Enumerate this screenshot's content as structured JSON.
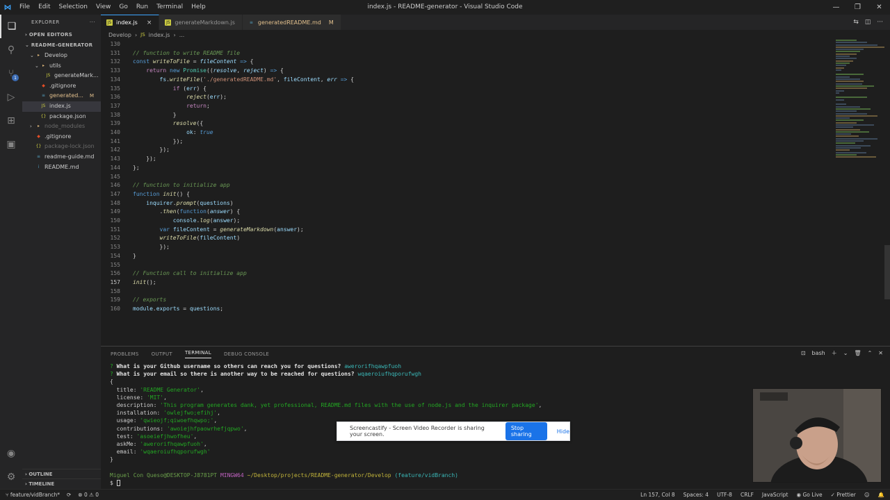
{
  "window": {
    "title": "index.js - README-generator - Visual Studio Code",
    "menu": [
      "File",
      "Edit",
      "Selection",
      "View",
      "Go",
      "Run",
      "Terminal",
      "Help"
    ]
  },
  "sidebar": {
    "header": "EXPLORER",
    "open_editors": "OPEN EDITORS",
    "project": "README-GENERATOR",
    "tree": [
      {
        "label": "Develop",
        "kind": "folder",
        "depth": 1,
        "open": true
      },
      {
        "label": "utils",
        "kind": "folder",
        "depth": 2,
        "open": true
      },
      {
        "label": "generateMark...",
        "kind": "js",
        "depth": 3
      },
      {
        "label": ".gitignore",
        "kind": "git",
        "depth": 2
      },
      {
        "label": "generated...",
        "kind": "md",
        "depth": 2,
        "mark": "M"
      },
      {
        "label": "index.js",
        "kind": "js",
        "depth": 2,
        "selected": true
      },
      {
        "label": "package.json",
        "kind": "json",
        "depth": 2
      },
      {
        "label": "node_modules",
        "kind": "folder",
        "depth": 1,
        "dim": true
      },
      {
        "label": ".gitignore",
        "kind": "git",
        "depth": 1
      },
      {
        "label": "package-lock.json",
        "kind": "json",
        "depth": 1,
        "dim": true
      },
      {
        "label": "readme-guide.md",
        "kind": "md",
        "depth": 1
      },
      {
        "label": "README.md",
        "kind": "info",
        "depth": 1
      }
    ],
    "outline": "OUTLINE",
    "timeline": "TIMELINE"
  },
  "tabs": [
    {
      "label": "index.js",
      "icon": "js-icon",
      "active": true,
      "close": "×"
    },
    {
      "label": "generateMarkdown.js",
      "icon": "js-icon"
    },
    {
      "label": "generatedREADME.md",
      "icon": "markdown-icon",
      "mark": "M"
    }
  ],
  "breadcrumb": [
    "Develop",
    "index.js",
    "..."
  ],
  "editor": {
    "current_line": "157",
    "lines": [
      {
        "n": "130",
        "t": ""
      },
      {
        "n": "131",
        "t": "// function to write README file",
        "c": true
      },
      {
        "n": "132",
        "h": "<span class='kw'>const</span> <span class='fn'>writeToFile</span> = <span class='param'>fileContent</span> <span class='kw'>=&gt;</span> {"
      },
      {
        "n": "133",
        "h": "    <span class='kc'>return</span> <span class='kw'>new</span> <span class='cls'>Promise</span>((<span class='param'>resolve</span>, <span class='param'>reject</span>) <span class='kw'>=&gt;</span> {"
      },
      {
        "n": "134",
        "h": "        <span class='var'>fs</span>.<span class='fn'>writeFile</span>(<span class='str'>'./generatedREADME.md'</span>, <span class='var'>fileContent</span>, <span class='param'>err</span> <span class='kw'>=&gt;</span> {"
      },
      {
        "n": "135",
        "h": "            <span class='kc'>if</span> (<span class='var'>err</span>) {"
      },
      {
        "n": "136",
        "h": "                <span class='fn'>reject</span>(<span class='var'>err</span>);"
      },
      {
        "n": "137",
        "h": "                <span class='kc'>return</span>;"
      },
      {
        "n": "138",
        "h": "            }"
      },
      {
        "n": "139",
        "h": "            <span class='fn'>resolve</span>({"
      },
      {
        "n": "140",
        "h": "                <span class='var'>ok</span>: <span class='bool'>true</span>"
      },
      {
        "n": "141",
        "h": "            });"
      },
      {
        "n": "142",
        "h": "        });"
      },
      {
        "n": "143",
        "h": "    });"
      },
      {
        "n": "144",
        "h": "};"
      },
      {
        "n": "145",
        "t": ""
      },
      {
        "n": "146",
        "t": "// function to initialize app",
        "c": true
      },
      {
        "n": "147",
        "h": "<span class='kw'>function</span> <span class='fn'>init</span>() {"
      },
      {
        "n": "148",
        "h": "    <span class='var'>inquirer</span>.<span class='fn'>prompt</span>(<span class='var'>questions</span>)"
      },
      {
        "n": "149",
        "h": "        .<span class='fn'>then</span>(<span class='kw'>function</span>(<span class='param'>answer</span>) {"
      },
      {
        "n": "150",
        "h": "            <span class='var'>console</span>.<span class='fn'>log</span>(<span class='var'>answer</span>);"
      },
      {
        "n": "151",
        "h": "        <span class='kw'>var</span> <span class='var'>fileContent</span> = <span class='fn'>generateMarkdown</span>(<span class='var'>answer</span>);"
      },
      {
        "n": "152",
        "h": "        <span class='fn'>writeToFile</span>(<span class='var'>fileContent</span>)"
      },
      {
        "n": "153",
        "h": "        });"
      },
      {
        "n": "154",
        "h": "}"
      },
      {
        "n": "155",
        "t": ""
      },
      {
        "n": "156",
        "t": "// Function call to initialize app",
        "c": true
      },
      {
        "n": "157",
        "h": "<span class='fn'>init</span>()<span style='color:#d4d4d4'>;</span>"
      },
      {
        "n": "158",
        "t": ""
      },
      {
        "n": "159",
        "t": "// exports",
        "c": true
      },
      {
        "n": "160",
        "h": "<span class='var'>module</span>.<span class='var'>exports</span> = <span class='var'>questions</span>;"
      }
    ]
  },
  "panel": {
    "tabs": [
      "PROBLEMS",
      "OUTPUT",
      "TERMINAL",
      "DEBUG CONSOLE"
    ],
    "active_tab": "TERMINAL",
    "shell": "bash",
    "terminal": [
      {
        "h": "<span class='s'>?</span> <span class='q'>What is your Github username so others can reach you for questions?</span> <span class='a'>awerorifhqawpfuoh</span>"
      },
      {
        "h": "<span class='s'>?</span> <span class='q'>What is your email so there is another way to be reached for questions?</span> <span class='a'>wqaeroiufhqporufwgh</span>"
      },
      {
        "h": "{"
      },
      {
        "h": "  title: <span class='s'>'README Generator'</span>,"
      },
      {
        "h": "  license: <span class='s'>'MIT'</span>,"
      },
      {
        "h": "  description: <span class='s'>'This program generates dank, yet professional, README.md files with the use of node.js and the inquirer package'</span>,"
      },
      {
        "h": "  installation: <span class='s'>'owlejfwo;efihj'</span>,"
      },
      {
        "h": "  usage: <span class='s'>'qwieojf;qiwoefhqwpo;'</span>,"
      },
      {
        "h": "  contributions: <span class='s'>'awoiejhfpaowrhefjqpwo'</span>,"
      },
      {
        "h": "  test: <span class='s'>'asoeiefjhwofheu'</span>,"
      },
      {
        "h": "  askMe: <span class='s'>'awerorifhqawpfuoh'</span>,"
      },
      {
        "h": "  email: <span class='s'>'wqaeroiufhqporufwgh'</span>"
      },
      {
        "h": "}"
      },
      {
        "h": ""
      },
      {
        "h": "<span class='g'>Miguel Con Queso@DESKTOP-J8781PT</span> <span class='p'>MINGW64</span> <span class='y'>~/Desktop/projects/README-generator/Develop</span> <span class='a'>(feature/vidBranch)</span>"
      },
      {
        "h": "$ <span style='display:inline-block;width:5px;height:9px;border:1px solid #ccc;vertical-align:middle'></span>"
      }
    ]
  },
  "banner": {
    "message": "Screencastify - Screen Video Recorder is sharing your screen.",
    "stop_label": "Stop sharing",
    "hide_label": "Hide"
  },
  "statusbar": {
    "branch": "feature/vidBranch*",
    "problems": "⊗ 0 ⚠ 0",
    "position": "Ln 157, Col 8",
    "spaces": "Spaces: 4",
    "encoding": "UTF-8",
    "eol": "CRLF",
    "language": "JavaScript",
    "golive": "Go Live",
    "prettier": "Prettier"
  }
}
